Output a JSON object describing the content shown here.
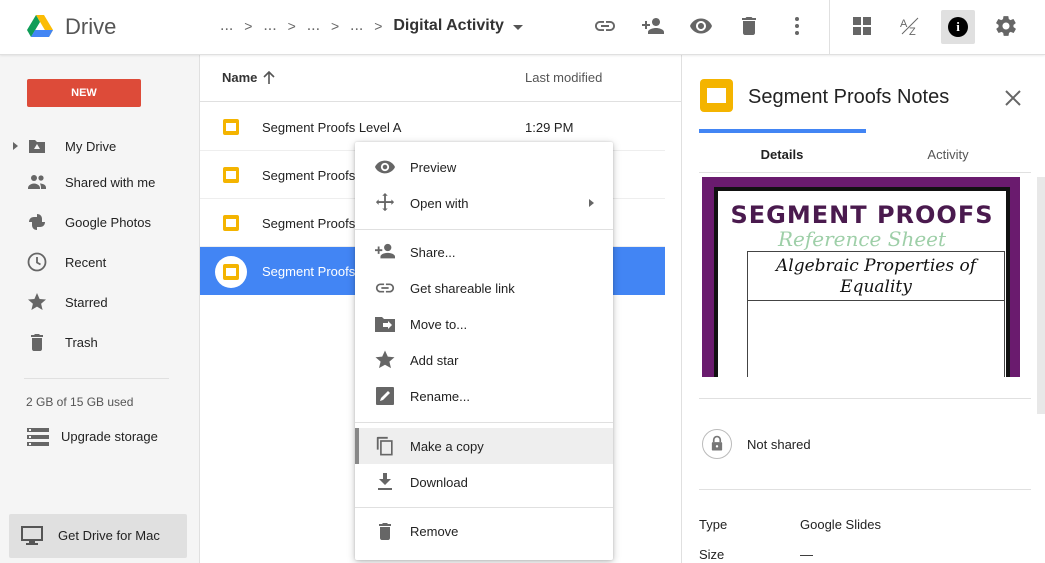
{
  "app": {
    "title": "Drive"
  },
  "breadcrumb": {
    "items": [
      "...",
      "...",
      "...",
      "..."
    ],
    "current": "Digital Activity"
  },
  "toolbar": {
    "icons": [
      "link-icon",
      "add-person-icon",
      "eye-icon",
      "trash-icon",
      "more-vert-icon",
      "grid-view-icon",
      "sort-az-icon",
      "info-icon",
      "settings-icon"
    ],
    "info_glyph": "i"
  },
  "sidebar": {
    "new_label": "NEW",
    "items": [
      {
        "label": "My Drive",
        "icon": "my-drive-icon"
      },
      {
        "label": "Shared with me",
        "icon": "people-icon"
      },
      {
        "label": "Google Photos",
        "icon": "photos-pinwheel-icon"
      },
      {
        "label": "Recent",
        "icon": "clock-icon"
      },
      {
        "label": "Starred",
        "icon": "star-icon"
      },
      {
        "label": "Trash",
        "icon": "trash-icon"
      }
    ],
    "storage": "2 GB of 15 GB used",
    "upgrade": "Upgrade storage",
    "get_drive": "Get Drive for Mac"
  },
  "filelist": {
    "col_name": "Name",
    "col_modified": "Last modified",
    "rows": [
      {
        "name": "Segment Proofs Level A",
        "modified": "1:29 PM"
      },
      {
        "name": "Segment Proofs",
        "modified": ""
      },
      {
        "name": "Segment Proofs",
        "modified": ""
      },
      {
        "name": "Segment Proofs",
        "modified": "",
        "selected": true
      }
    ]
  },
  "context_menu": {
    "items": [
      {
        "label": "Preview",
        "icon": "eye-icon"
      },
      {
        "label": "Open with",
        "icon": "move-arrows-icon",
        "submenu": true
      },
      {
        "label": "Share...",
        "icon": "add-person-icon"
      },
      {
        "label": "Get shareable link",
        "icon": "link-icon"
      },
      {
        "label": "Move to...",
        "icon": "folder-move-icon"
      },
      {
        "label": "Add star",
        "icon": "star-icon"
      },
      {
        "label": "Rename...",
        "icon": "edit-icon"
      },
      {
        "label": "Make a copy",
        "icon": "copy-icon",
        "hover": true
      },
      {
        "label": "Download",
        "icon": "download-icon"
      },
      {
        "label": "Remove",
        "icon": "trash-icon"
      }
    ]
  },
  "details": {
    "title": "Segment Proofs Notes",
    "tabs": [
      "Details",
      "Activity"
    ],
    "preview": {
      "title": "SEGMENT PROOFS",
      "subtitle": "Reference Sheet",
      "box_text": "Algebraic Properties of Equality"
    },
    "sharing": "Not shared",
    "meta": [
      {
        "label": "Type",
        "value": "Google Slides"
      },
      {
        "label": "Size",
        "value": "—"
      }
    ]
  },
  "colors": {
    "new_button": "#dd4b39",
    "selection": "#4285f4",
    "slides_icon": "#f4b400",
    "preview_bg": "#6a1b6e"
  }
}
